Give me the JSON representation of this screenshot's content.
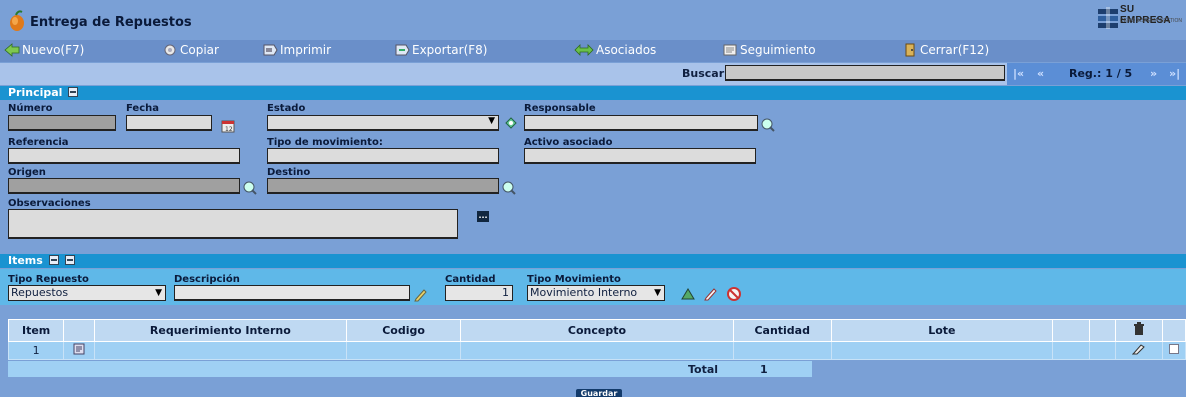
{
  "window": {
    "title": "Entrega de Repuestos"
  },
  "logo": {
    "brand": "SU EMPRESA",
    "tagline": "DEMO SISTEMA GESTION"
  },
  "toolbar": {
    "new": "Nuevo(F7)",
    "copy": "Copiar",
    "print": "Imprimir",
    "export": "Exportar(F8)",
    "associated": "Asociados",
    "tracking": "Seguimiento",
    "close": "Cerrar(F12)"
  },
  "search": {
    "label": "Buscar",
    "value": "",
    "nav_first": "|«",
    "nav_prev": "«",
    "record": "Reg.: 1 / 5",
    "nav_next": "»",
    "nav_last": "»|"
  },
  "principal": {
    "title": "Principal",
    "numero_label": "Número",
    "fecha_label": "Fecha",
    "estado_label": "Estado",
    "responsable_label": "Responsable",
    "referencia_label": "Referencia",
    "tipo_mov_label": "Tipo de movimiento:",
    "activo_label": "Activo asociado",
    "origen_label": "Origen",
    "destino_label": "Destino",
    "observaciones_label": "Observaciones",
    "more_button": "..."
  },
  "items": {
    "title": "Items",
    "tipo_repuesto_label": "Tipo Repuesto",
    "tipo_repuesto_value": "Repuestos",
    "descripcion_label": "Descripción",
    "cantidad_label": "Cantidad",
    "cantidad_value": "1",
    "tipo_mov_label": "Tipo Movimiento",
    "tipo_mov_value": "Movimiento Interno"
  },
  "table": {
    "headers": [
      "Item",
      "",
      "Requerimiento Interno",
      "Codigo",
      "Concepto",
      "Cantidad",
      "Lote",
      "",
      "",
      "",
      ""
    ],
    "rows": [
      {
        "item": "1"
      }
    ],
    "total_label": "Total",
    "total_value": "1"
  },
  "save_button": "Guardar"
}
